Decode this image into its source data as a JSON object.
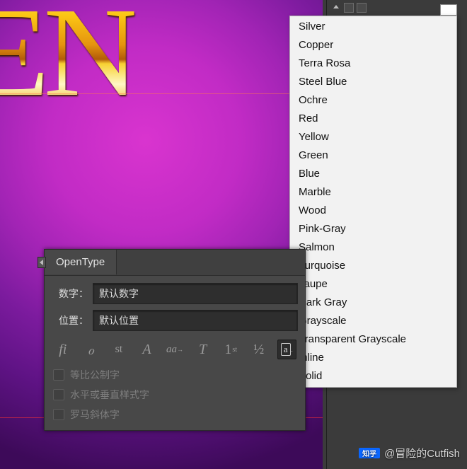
{
  "artwork": {
    "text": "EN"
  },
  "menu": {
    "items": [
      "Silver",
      "Copper",
      "Terra Rosa",
      "Steel Blue",
      "Ochre",
      "Red",
      "Yellow",
      "Green",
      "Blue",
      "Marble",
      "Wood",
      "Pink-Gray",
      "Salmon",
      "Turquoise",
      "Taupe",
      "Dark Gray",
      "Grayscale",
      "Transparent Grayscale",
      "Inline",
      "Solid"
    ]
  },
  "panel": {
    "tab": "OpenType",
    "rows": {
      "figure": {
        "label": "数字：",
        "value": "默认数字"
      },
      "position": {
        "label": "位置：",
        "value": "默认位置"
      }
    },
    "icons": {
      "ligature": "fi",
      "swash": "ℴ",
      "stylistic": "st",
      "titling": "A",
      "contextual": "aa",
      "smallcaps": "T",
      "ordinal": "1",
      "ordinal_sup": "st",
      "fraction": "½",
      "boxed": "a"
    },
    "checks": {
      "tab_lining": "等比公制字",
      "h_v_stylistic": "水平或垂直样式字",
      "roman_italic": "罗马斜体字"
    }
  },
  "watermark": {
    "logo": "知乎",
    "text": "@冒险的Cutfish"
  }
}
